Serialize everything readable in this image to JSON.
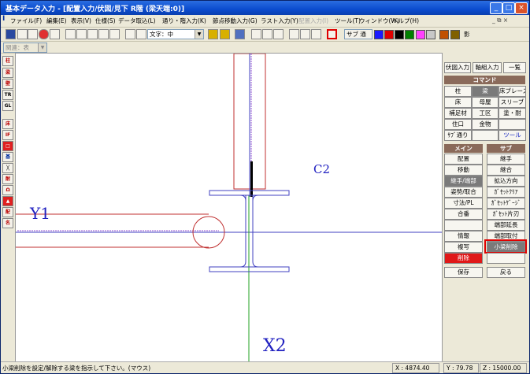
{
  "window": {
    "title": "基本データ入力 - [配置入力/伏図/見下 R階 (梁天端:0)]"
  },
  "menu": [
    {
      "label": "ファイル(F)",
      "disabled": false
    },
    {
      "label": "編集(E)",
      "disabled": false
    },
    {
      "label": "表示(V)",
      "disabled": false
    },
    {
      "label": "仕様(S)",
      "disabled": false
    },
    {
      "label": "データ取込(L)",
      "disabled": false
    },
    {
      "label": "通り・階入力(K)",
      "disabled": false
    },
    {
      "label": "節点移動入力(G)",
      "disabled": false
    },
    {
      "label": "ラスト入力(Y)",
      "disabled": false
    },
    {
      "label": "配置入力(I)",
      "disabled": true
    },
    {
      "label": "ツール(T)",
      "disabled": false
    },
    {
      "label": "ウィンドウ(W)",
      "disabled": false
    },
    {
      "label": "ヘルプ(H)",
      "disabled": false
    }
  ],
  "toolbar": {
    "text_size_combo": "文字：中",
    "sub_label": "サブ 通",
    "last_label": "影",
    "colors": [
      "#1a1aff",
      "#e00000",
      "#000000",
      "#008000",
      "#ff40ff",
      "#c8c8c8",
      "#c05000",
      "#806000"
    ]
  },
  "toolbar2": {
    "combo": "関連：表"
  },
  "left_tools": [
    "柱",
    "梁",
    "壁",
    "TR",
    "GL",
    "床",
    "IF",
    "□",
    "基",
    "╳",
    "耐",
    "Ω",
    "▲",
    "配",
    "名"
  ],
  "canvas": {
    "label_c2": "C2",
    "label_y1": "Y1",
    "label_x2": "X2"
  },
  "panel": {
    "tabs": [
      "伏図入力",
      "軸組入力",
      "一覧"
    ],
    "command_header": "コマンド",
    "command_rows": [
      [
        "柱",
        "梁",
        "床ブレース"
      ],
      [
        "床",
        "母屋",
        "スリーブ"
      ],
      [
        "補足材",
        "工区",
        "塗・耐"
      ],
      [
        "住口",
        "金物",
        ""
      ],
      [
        "ｻﾌﾞ通り",
        "",
        "ツール"
      ]
    ],
    "main_header": "メイン",
    "sub_header": "サブ",
    "main_buttons": [
      "配置",
      "移動",
      "継手/端部",
      "姿勢/取合",
      "寸法/PL",
      "合番",
      "",
      "情報",
      "複写",
      "削除"
    ],
    "sub_buttons": [
      "継手",
      "継合",
      "拡込方向",
      "ｶﾞｾｯﾄｸﾘｱ",
      "ｶﾞｾｯﾄｹﾞｰｼﾞ",
      "ｶﾞｾｯﾄ片刃",
      "端部延長",
      "端部取付",
      "小梁削除",
      ""
    ],
    "save": "保存",
    "back": "戻る"
  },
  "status": {
    "message": "小梁削除を設定/解除する梁を指示して下さい。(マウス)",
    "x": "X : 4874.40",
    "y": "Y : 79.78",
    "z": "Z : 15000.00"
  }
}
